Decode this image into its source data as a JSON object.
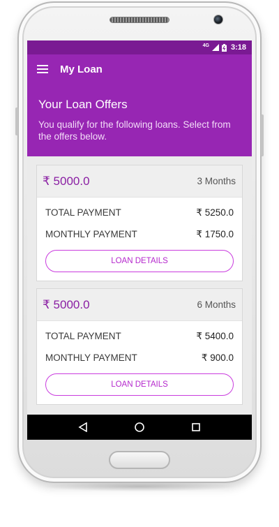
{
  "status_bar": {
    "network": "4G",
    "time": "3:18"
  },
  "app_bar": {
    "title": "My Loan",
    "menu_icon": "hamburger-menu-icon"
  },
  "hero": {
    "title": "Your Loan Offers",
    "subtitle": "You qualify for the following loans. Select from the offers below."
  },
  "offers": [
    {
      "amount": "₹ 5000.0",
      "tenure": "3 Months",
      "total_label": "TOTAL PAYMENT",
      "total_value": "₹ 5250.0",
      "monthly_label": "MONTHLY PAYMENT",
      "monthly_value": "₹ 1750.0",
      "button": "LOAN DETAILS"
    },
    {
      "amount": "₹ 5000.0",
      "tenure": "6 Months",
      "total_label": "TOTAL PAYMENT",
      "total_value": "₹ 5400.0",
      "monthly_label": "MONTHLY PAYMENT",
      "monthly_value": "₹ 900.0",
      "button": "LOAN DETAILS"
    }
  ],
  "nav_bar": {
    "back_icon": "back-triangle-icon",
    "home_icon": "home-circle-icon",
    "recents_icon": "recents-square-icon"
  },
  "colors": {
    "primary": "#9726b3",
    "primary_dark": "#7a1a93",
    "accent": "#b427cc"
  }
}
